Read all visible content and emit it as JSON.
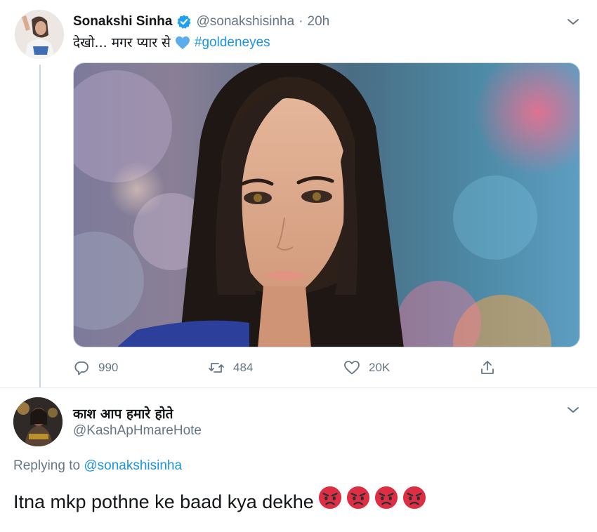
{
  "tweet": {
    "author_name": "Sonakshi Sinha",
    "author_handle": "@sonakshisinha",
    "separator": "·",
    "time": "20h",
    "text": "देखो... मगर प्यार से",
    "hashtag": "#goldeneyes",
    "stats": {
      "replies": "990",
      "retweets": "484",
      "likes": "20K"
    }
  },
  "reply": {
    "author_name": "काश आप हमारे होते",
    "author_handle": "@KashApHmareHote",
    "replying_prefix": "Replying to",
    "replying_mention": "@sonakshisinha",
    "text": "Itna mkp pothne ke baad kya dekhe",
    "emoji": "angry-face",
    "emoji_count": 4
  },
  "colors": {
    "link": "#1b95e0",
    "secondary_text": "#657786",
    "verified": "#1da1f2",
    "divider": "#e6ecf0"
  }
}
